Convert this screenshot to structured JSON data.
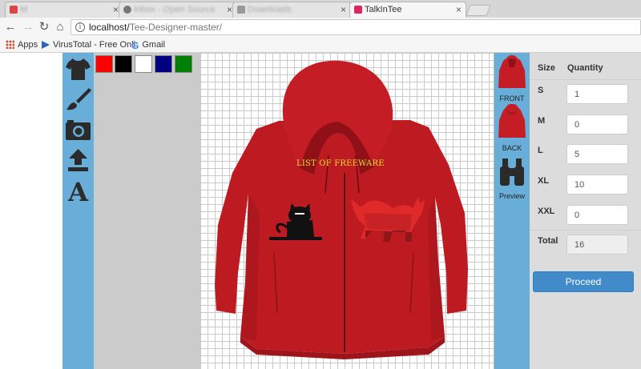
{
  "browser": {
    "tabs": [
      {
        "label": "M",
        "blurred": true
      },
      {
        "label": "Inbox - Open Source",
        "blurred": true
      },
      {
        "label": "Downloads",
        "blurred": true
      },
      {
        "label": "TalkInTee",
        "blurred": false
      }
    ],
    "url_host": "localhost/",
    "url_path": "Tee-Designer-master/",
    "bookmarks": [
      "Apps",
      "VirusTotal - Free Onli",
      "Gmail"
    ]
  },
  "design": {
    "overlay_text": "LIST OF FREEWARE",
    "swatches": [
      "#ff0000",
      "#000000",
      "#ffffff",
      "#000080",
      "#008000"
    ],
    "tools": [
      "tshirt-icon",
      "brush-icon",
      "camera-icon",
      "upload-icon",
      "text-icon"
    ]
  },
  "views": {
    "front": "FRONT",
    "back": "BACK",
    "preview": "Preview"
  },
  "order": {
    "size_header": "Size",
    "quantity_header": "Quantity",
    "rows": [
      {
        "size": "S",
        "qty": "1"
      },
      {
        "size": "M",
        "qty": "0"
      },
      {
        "size": "L",
        "qty": "5"
      },
      {
        "size": "XL",
        "qty": "10"
      },
      {
        "size": "XXL",
        "qty": "0"
      }
    ],
    "total_label": "Total",
    "total": "16",
    "proceed_label": "Proceed"
  }
}
